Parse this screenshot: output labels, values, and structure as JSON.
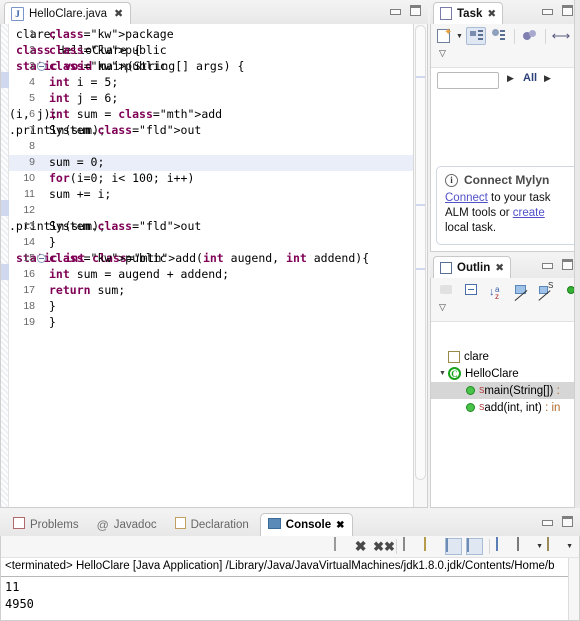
{
  "editor": {
    "tab": {
      "label": "HelloClare.java",
      "icon": "java-file-icon",
      "close": "✖",
      "file_letter": "J"
    },
    "window_buttons": {
      "minimize": "minimize-icon",
      "maximize": "maximize-icon"
    },
    "current_line": 9,
    "lines": [
      {
        "n": 1,
        "fold": false,
        "text": "package clare;"
      },
      {
        "n": 2,
        "fold": false,
        "text": "public class HelloClare {"
      },
      {
        "n": 3,
        "fold": true,
        "text": "public static void main(String[] args) {"
      },
      {
        "n": 4,
        "fold": false,
        "text": "int i = 5;"
      },
      {
        "n": 5,
        "fold": false,
        "text": "int j = 6;"
      },
      {
        "n": 6,
        "fold": false,
        "text": "int sum = add(i, j);"
      },
      {
        "n": 7,
        "fold": false,
        "text": "System.out.println(sum);"
      },
      {
        "n": 8,
        "fold": false,
        "text": ""
      },
      {
        "n": 9,
        "fold": false,
        "text": "sum = 0;"
      },
      {
        "n": 10,
        "fold": false,
        "text": "for(i=0; i< 100; i++)"
      },
      {
        "n": 11,
        "fold": false,
        "text": "sum += i;"
      },
      {
        "n": 12,
        "fold": false,
        "text": ""
      },
      {
        "n": 13,
        "fold": false,
        "text": "System.out.println(sum);"
      },
      {
        "n": 14,
        "fold": false,
        "text": "}"
      },
      {
        "n": 15,
        "fold": true,
        "text": "public static int add(int augend, int addend){"
      },
      {
        "n": 16,
        "fold": false,
        "text": "int sum = augend + addend;"
      },
      {
        "n": 17,
        "fold": false,
        "text": "return sum;"
      },
      {
        "n": 18,
        "fold": false,
        "text": "}"
      },
      {
        "n": 19,
        "fold": false,
        "text": "}"
      }
    ]
  },
  "task_view": {
    "tab": {
      "label": "Task",
      "close": "✖",
      "icon": "task-list-icon"
    },
    "toolbar": [
      {
        "name": "new-task-button",
        "icon": "new-task-icon"
      },
      {
        "name": "new-task-dropdown",
        "icon": "chevron-down-icon"
      },
      {
        "name": "categorized-view-button",
        "icon": "categorized-tree-icon"
      },
      {
        "name": "scheduled-view-button",
        "icon": "scheduled-tree-icon"
      },
      {
        "name": "synchronize-button",
        "icon": "synchronize-icon"
      },
      {
        "name": "focus-button",
        "icon": "arrow-icon"
      },
      {
        "name": "view-menu-button",
        "icon": "chevron-down-icon"
      }
    ],
    "filter": {
      "search_value": "",
      "search_placeholder": "",
      "prev": "▶",
      "label": "All",
      "next": "▶"
    },
    "mylyn": {
      "title": "Connect Mylyn",
      "info_icon": "i",
      "line1_link": "Connect",
      "line1_rest": " to your task",
      "line2_rest": "ALM tools or ",
      "line2_link": "create",
      "line3": "local task."
    }
  },
  "outline_view": {
    "tab": {
      "label": "Outlin",
      "close": "✖",
      "icon": "outline-icon"
    },
    "window_buttons": {
      "minimize": "minimize-icon",
      "maximize": "maximize-icon"
    },
    "toolbar": [
      {
        "name": "focus-on-active-task-button",
        "icon": "focus-icon"
      },
      {
        "name": "collapse-all-button",
        "icon": "collapse-all-icon"
      },
      {
        "name": "sort-button",
        "icon": "sort-az-icon"
      },
      {
        "name": "hide-fields-button",
        "icon": "hide-fields-icon"
      },
      {
        "name": "hide-static-button",
        "icon": "hide-static-icon"
      },
      {
        "name": "hide-non-public-button",
        "icon": "hide-non-public-icon"
      },
      {
        "name": "view-menu-button",
        "icon": "chevron-down-icon"
      }
    ],
    "tree": [
      {
        "indent": 0,
        "twisty": "",
        "icon": "package-icon",
        "label": "clare",
        "selected": false,
        "static": false,
        "ret": ""
      },
      {
        "indent": 0,
        "twisty": "▼",
        "icon": "class-icon",
        "label": "HelloClare",
        "selected": false,
        "static": false,
        "ret": ""
      },
      {
        "indent": 1,
        "twisty": "",
        "icon": "method-icon",
        "label": "main(String[]) ",
        "selected": true,
        "static": true,
        "ret": ":"
      },
      {
        "indent": 1,
        "twisty": "",
        "icon": "method-icon",
        "label": "add(int, int) ",
        "selected": false,
        "static": true,
        "ret": ": in"
      }
    ]
  },
  "bottom_panel": {
    "tabs": [
      {
        "label": "Problems",
        "icon": "problems-icon",
        "active": false
      },
      {
        "label": "Javadoc",
        "icon": "javadoc-icon",
        "active": false
      },
      {
        "label": "Declaration",
        "icon": "declaration-icon",
        "active": false
      },
      {
        "label": "Console",
        "icon": "console-icon",
        "active": true,
        "close": "✖"
      }
    ],
    "window_buttons": {
      "minimize": "minimize-icon",
      "maximize": "maximize-icon"
    },
    "toolbar": [
      {
        "name": "terminate-button",
        "icon": "stop-square-icon"
      },
      {
        "name": "remove-launch-button",
        "icon": "x-icon"
      },
      {
        "name": "remove-all-button",
        "icon": "xx-icon"
      },
      {
        "name": "clear-console-button",
        "icon": "clear-console-icon"
      },
      {
        "name": "scroll-lock-button",
        "icon": "lock-icon"
      },
      {
        "name": "show-console-button",
        "icon": "show-console-icon"
      },
      {
        "name": "close-console-button",
        "icon": "close-console-icon"
      },
      {
        "name": "pin-console-button",
        "icon": "pin-console-icon"
      },
      {
        "name": "display-console-button",
        "icon": "display-console-icon"
      },
      {
        "name": "display-console-dropdown",
        "icon": "chevron-down-icon"
      },
      {
        "name": "open-console-button",
        "icon": "open-console-icon"
      },
      {
        "name": "open-console-dropdown",
        "icon": "chevron-down-icon"
      }
    ],
    "console_header": "<terminated> HelloClare [Java Application] /Library/Java/JavaVirtualMachines/jdk1.8.0.jdk/Contents/Home/b",
    "console_output": "11\n4950"
  },
  "colors": {
    "keyword": "#7f0055",
    "field": "#0000c0",
    "current_line": "#e9eef9",
    "selection": "#d6d6d6",
    "link": "#5050c8",
    "method_dot": "#49c34a"
  }
}
